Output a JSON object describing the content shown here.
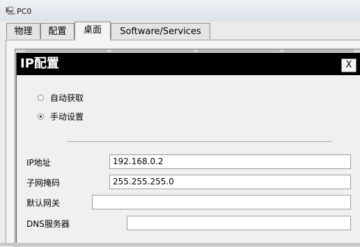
{
  "window": {
    "title": "PC0",
    "icon": "pc-icon"
  },
  "tabs": [
    {
      "label": "物理",
      "active": false
    },
    {
      "label": "配置",
      "active": false
    },
    {
      "label": "桌面",
      "active": true
    },
    {
      "label": "Software/Services",
      "active": false
    }
  ],
  "dialog": {
    "title": "IP配置",
    "close_label": "X",
    "radios": [
      {
        "label": "自动获取",
        "checked": false
      },
      {
        "label": "手动设置",
        "checked": true
      }
    ],
    "fields": [
      {
        "label": "IP地址",
        "value": "192.168.0.2"
      },
      {
        "label": "子网掩码",
        "value": "255.255.255.0"
      },
      {
        "label": "默认网关",
        "value": ""
      },
      {
        "label": "DNS服务器",
        "value": ""
      }
    ]
  }
}
